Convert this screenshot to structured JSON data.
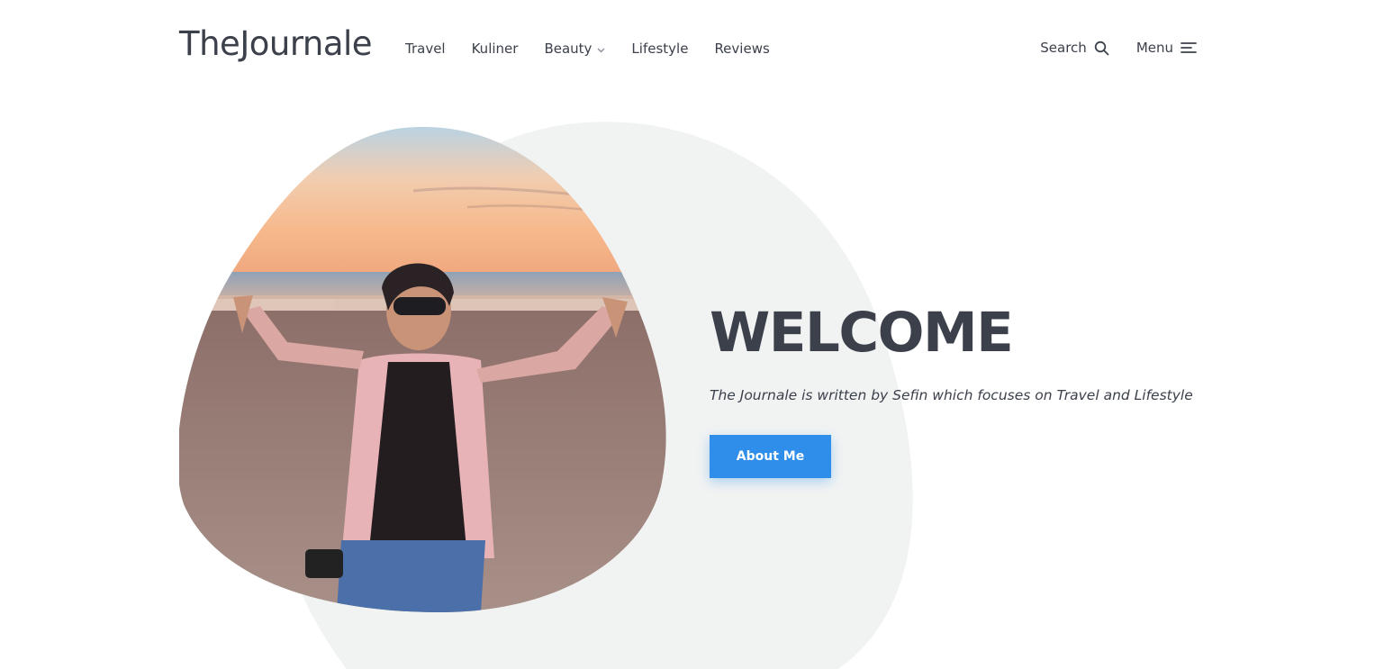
{
  "brand": {
    "logo_text": "TheJournale"
  },
  "nav": {
    "items": [
      {
        "label": "Travel"
      },
      {
        "label": "Kuliner"
      },
      {
        "label": "Beauty",
        "has_dropdown": true
      },
      {
        "label": "Lifestyle"
      },
      {
        "label": "Reviews"
      }
    ]
  },
  "header_actions": {
    "search_label": "Search",
    "search_icon": "search-icon",
    "menu_label": "Menu",
    "menu_icon": "hamburger-icon"
  },
  "hero": {
    "title": "WELCOME",
    "subtitle": "The Journale is written by Sefin which focuses on Travel and Lifestyle",
    "cta_label": "About Me",
    "image_subject": "woman-on-beach-at-sunset"
  },
  "colors": {
    "text": "#3b404b",
    "accent": "#2f8ee9",
    "blob_bg": "#f1f3f3",
    "background": "#ffffff"
  }
}
